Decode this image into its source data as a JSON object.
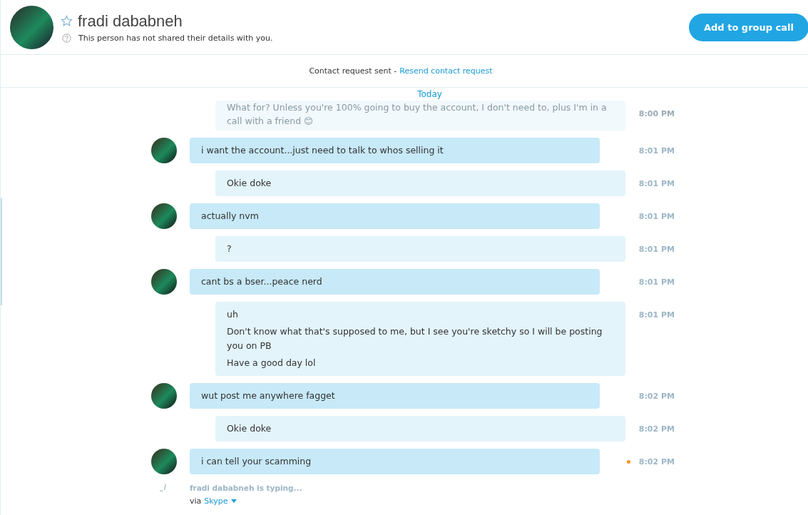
{
  "contact": {
    "name": "fradi dababneh",
    "status": "This person has not shared their details with you."
  },
  "add_button": "Add to group call",
  "request": {
    "text": "Contact request sent -",
    "link": "Resend contact request"
  },
  "date_divider": "Today",
  "messages": [
    {
      "kind": "outgoing",
      "faded": true,
      "pending": false,
      "lines": [
        "What for? Unless you're 100% going to buy the account, I don't need to, plus I'm in a call with a friend 😊"
      ],
      "time": "8:00 PM"
    },
    {
      "kind": "incoming",
      "faded": false,
      "pending": false,
      "lines": [
        "i want the account...just need to talk to whos selling it"
      ],
      "time": "8:01 PM"
    },
    {
      "kind": "outgoing",
      "faded": false,
      "pending": false,
      "lines": [
        "Okie doke"
      ],
      "time": "8:01 PM"
    },
    {
      "kind": "incoming",
      "faded": false,
      "pending": false,
      "lines": [
        "actually nvm"
      ],
      "time": "8:01 PM"
    },
    {
      "kind": "outgoing",
      "faded": false,
      "pending": false,
      "lines": [
        "?"
      ],
      "time": "8:01 PM"
    },
    {
      "kind": "incoming",
      "faded": false,
      "pending": false,
      "lines": [
        "cant bs a bser...peace nerd"
      ],
      "time": "8:01 PM"
    },
    {
      "kind": "outgoing",
      "faded": false,
      "pending": false,
      "lines": [
        "uh",
        "Don't know what that's supposed to me, but I see you're sketchy so I will be posting you on PB",
        "Have a good day lol"
      ],
      "time": "8:01 PM"
    },
    {
      "kind": "incoming",
      "faded": false,
      "pending": false,
      "lines": [
        "wut post me anywhere fagget"
      ],
      "time": "8:02 PM"
    },
    {
      "kind": "outgoing",
      "faded": false,
      "pending": false,
      "lines": [
        "Okie doke"
      ],
      "time": "8:02 PM"
    },
    {
      "kind": "incoming",
      "faded": false,
      "pending": true,
      "lines": [
        "i can tell your scamming"
      ],
      "time": "8:02 PM"
    }
  ],
  "typing": "fradi dababneh is typing...",
  "via": {
    "label": "via",
    "link": "Skype"
  }
}
